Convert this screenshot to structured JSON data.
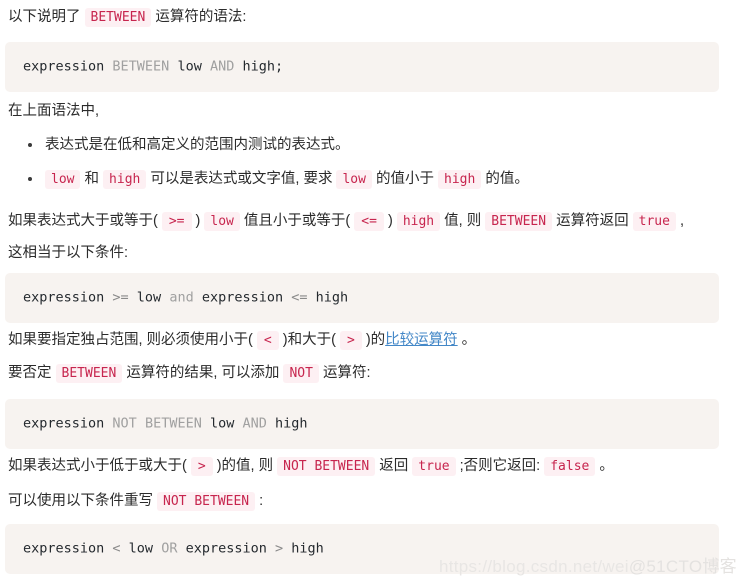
{
  "document": {
    "blocks": [
      {
        "id": "intro-paragraph",
        "type": "paragraph",
        "name": "paragraph-syntax-intro",
        "runs": [
          {
            "t": "text",
            "v": "以下说明了 "
          },
          {
            "t": "code",
            "v": "BETWEEN"
          },
          {
            "t": "text",
            "v": " 运算符的语法:"
          }
        ]
      },
      {
        "id": "code-block-1",
        "type": "codeblock",
        "name": "code-block-between-syntax",
        "tokens": [
          {
            "t": "pl",
            "v": "expression "
          },
          {
            "t": "kw",
            "v": "BETWEEN"
          },
          {
            "t": "pl",
            "v": " low "
          },
          {
            "t": "kw",
            "v": "AND"
          },
          {
            "t": "pl",
            "v": " high;"
          }
        ],
        "plain": "expression BETWEEN low AND high;"
      },
      {
        "id": "para-in-syntax",
        "type": "paragraph",
        "name": "paragraph-in-above-syntax",
        "runs": [
          {
            "t": "text",
            "v": "在上面语法中,"
          }
        ]
      },
      {
        "id": "bullet-list",
        "type": "list",
        "name": "bullet-list-syntax-terms",
        "items": [
          {
            "name": "list-item-expression",
            "runs": [
              {
                "t": "text",
                "v": "表达式是在低和高定义的范围内测试的表达式。"
              }
            ]
          },
          {
            "name": "list-item-low-high",
            "runs": [
              {
                "t": "code",
                "v": "low"
              },
              {
                "t": "text",
                "v": " 和 "
              },
              {
                "t": "code",
                "v": "high"
              },
              {
                "t": "text",
                "v": " 可以是表达式或文字值, 要求 "
              },
              {
                "t": "code",
                "v": "low"
              },
              {
                "t": "text",
                "v": " 的值小于 "
              },
              {
                "t": "code",
                "v": "high"
              },
              {
                "t": "text",
                "v": " 的值。"
              }
            ]
          }
        ]
      },
      {
        "id": "para-returns-true",
        "type": "paragraph",
        "name": "paragraph-returns-true-condition",
        "runs": [
          {
            "t": "text",
            "v": "如果表达式大于或等于( "
          },
          {
            "t": "code",
            "v": ">="
          },
          {
            "t": "text",
            "v": " ) "
          },
          {
            "t": "code",
            "v": "low"
          },
          {
            "t": "text",
            "v": " 值且小于或等于( "
          },
          {
            "t": "code",
            "v": "<="
          },
          {
            "t": "text",
            "v": " ) "
          },
          {
            "t": "code",
            "v": "high"
          },
          {
            "t": "text",
            "v": " 值, 则 "
          },
          {
            "t": "code",
            "v": "BETWEEN"
          },
          {
            "t": "text",
            "v": " 运算符返回 "
          },
          {
            "t": "code",
            "v": "true"
          },
          {
            "t": "text",
            "v": " ,"
          }
        ]
      },
      {
        "id": "para-equivalent",
        "type": "paragraph",
        "name": "paragraph-equivalent-to",
        "runs": [
          {
            "t": "text",
            "v": "这相当于以下条件:"
          }
        ]
      },
      {
        "id": "code-block-2",
        "type": "codeblock",
        "name": "code-block-equivalent-condition",
        "tokens": [
          {
            "t": "pl",
            "v": "expression "
          },
          {
            "t": "op",
            "v": ">="
          },
          {
            "t": "pl",
            "v": " low "
          },
          {
            "t": "kw",
            "v": "and"
          },
          {
            "t": "pl",
            "v": " expression "
          },
          {
            "t": "op",
            "v": "<="
          },
          {
            "t": "pl",
            "v": " high"
          }
        ],
        "plain": "expression >= low and expression <= high"
      },
      {
        "id": "para-exclusive-range",
        "type": "paragraph",
        "name": "paragraph-exclusive-range",
        "runs": [
          {
            "t": "text",
            "v": "如果要指定独占范围, 则必须使用小于( "
          },
          {
            "t": "code",
            "v": "<"
          },
          {
            "t": "text",
            "v": " )和大于( "
          },
          {
            "t": "code",
            "v": ">"
          },
          {
            "t": "text",
            "v": " )的"
          },
          {
            "t": "link",
            "v": "比较运算符"
          },
          {
            "t": "text",
            "v": " 。"
          }
        ]
      },
      {
        "id": "para-negate",
        "type": "paragraph",
        "name": "paragraph-negate-between",
        "runs": [
          {
            "t": "text",
            "v": "要否定 "
          },
          {
            "t": "code",
            "v": "BETWEEN"
          },
          {
            "t": "text",
            "v": " 运算符的结果, 可以添加 "
          },
          {
            "t": "code",
            "v": "NOT"
          },
          {
            "t": "text",
            "v": " 运算符:"
          }
        ]
      },
      {
        "id": "code-block-3",
        "type": "codeblock",
        "name": "code-block-not-between-syntax",
        "tokens": [
          {
            "t": "pl",
            "v": "expression "
          },
          {
            "t": "kw",
            "v": "NOT"
          },
          {
            "t": "pl",
            "v": " "
          },
          {
            "t": "kw",
            "v": "BETWEEN"
          },
          {
            "t": "pl",
            "v": " low "
          },
          {
            "t": "kw",
            "v": "AND"
          },
          {
            "t": "pl",
            "v": " high"
          }
        ],
        "plain": "expression NOT BETWEEN low AND high"
      },
      {
        "id": "para-not-between-returns",
        "type": "paragraph",
        "name": "paragraph-not-between-returns",
        "runs": [
          {
            "t": "text",
            "v": "如果表达式小于低于或大于( "
          },
          {
            "t": "code",
            "v": ">"
          },
          {
            "t": "text",
            "v": " )的值, 则 "
          },
          {
            "t": "code",
            "v": "NOT BETWEEN"
          },
          {
            "t": "text",
            "v": " 返回 "
          },
          {
            "t": "code",
            "v": "true"
          },
          {
            "t": "text",
            "v": " ;否则它返回: "
          },
          {
            "t": "code",
            "v": "false"
          },
          {
            "t": "text",
            "v": " 。"
          }
        ]
      },
      {
        "id": "para-rewrite",
        "type": "paragraph",
        "name": "paragraph-rewrite-not-between",
        "runs": [
          {
            "t": "text",
            "v": "可以使用以下条件重写 "
          },
          {
            "t": "code",
            "v": "NOT BETWEEN"
          },
          {
            "t": "text",
            "v": " :"
          }
        ]
      },
      {
        "id": "code-block-4",
        "type": "codeblock",
        "name": "code-block-not-between-rewrite",
        "tokens": [
          {
            "t": "pl",
            "v": "expression "
          },
          {
            "t": "op",
            "v": "<"
          },
          {
            "t": "pl",
            "v": " low "
          },
          {
            "t": "kw",
            "v": "OR"
          },
          {
            "t": "pl",
            "v": " expression "
          },
          {
            "t": "op",
            "v": ">"
          },
          {
            "t": "pl",
            "v": " high"
          }
        ],
        "plain": "expression < low OR expression > high"
      }
    ]
  },
  "watermark": {
    "url": "https://blog.csdn.net/wei",
    "brand": "@51CTO博客"
  },
  "colors": {
    "inline_code_bg": "#fdf0f3",
    "inline_code_fg": "#c7254e",
    "code_block_bg": "#f7f3f0",
    "link": "#4387c7",
    "body_text": "#2b2b2b",
    "keyword": "#a0a0a0",
    "watermark": "#e8e6e4"
  }
}
